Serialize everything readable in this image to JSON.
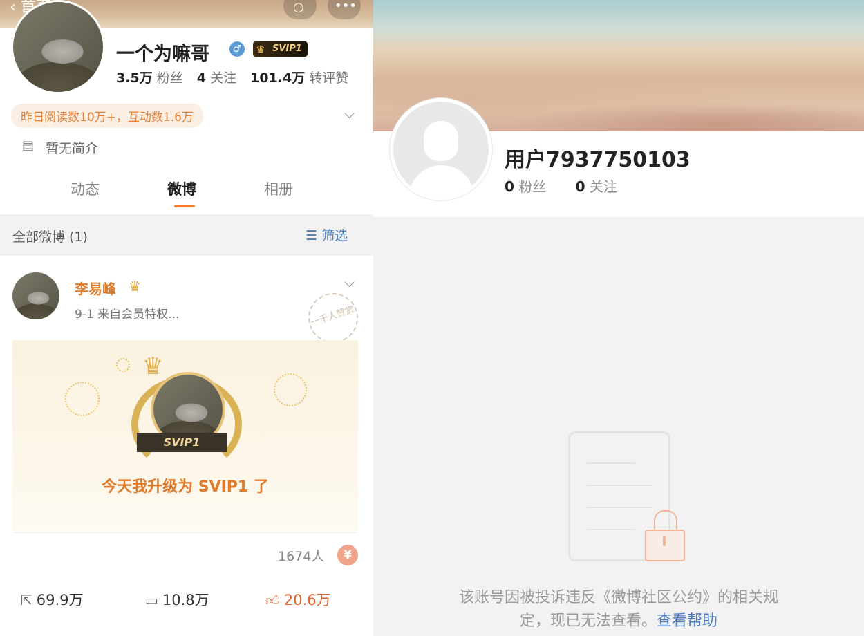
{
  "left": {
    "nav": {
      "back_label": "首页",
      "back_icon": "chevron-left",
      "search_icon": "search",
      "more_icon": "more-horizontal"
    },
    "profile": {
      "name": "一个为嘛哥",
      "gender_icon": "♂",
      "vip_badge": "SVIP1",
      "followers_num": "3.5万",
      "followers_label": "粉丝",
      "following_num": "4",
      "following_label": "关注",
      "reposts_num": "101.4万",
      "reposts_label": "转评赞",
      "highlight": "昨日阅读数10万+，互动数1.6万",
      "bio": "暂无简介"
    },
    "tabs": [
      {
        "label": "动态"
      },
      {
        "label": "微博",
        "active": true
      },
      {
        "label": "相册"
      }
    ],
    "filter": {
      "label": "全部微博 (1)",
      "button": "筛选"
    },
    "post": {
      "author": "李易峰",
      "meta": "9-1  来自会员特权...",
      "stamp": "一千人赞赏",
      "card_badge": "SVIP1",
      "card_text": "今天我升级为 SVIP1 了",
      "viewers": "1674人",
      "coin_icon": "¥",
      "repost_count": "69.9万",
      "comment_count": "10.8万",
      "like_count": "20.6万"
    }
  },
  "right": {
    "username": "用户7937750103",
    "followers_num": "0",
    "followers_label": "粉丝",
    "following_num": "0",
    "following_label": "关注",
    "message_line1": "该账号因被投诉违反《微博社区公约》的相关规",
    "message_line2": "定，现已无法查看。",
    "help_link": "查看帮助"
  },
  "colors": {
    "accent_orange": "#f07c2e",
    "link_blue": "#4a7bbd",
    "bg_gray": "#f2f2f2"
  }
}
